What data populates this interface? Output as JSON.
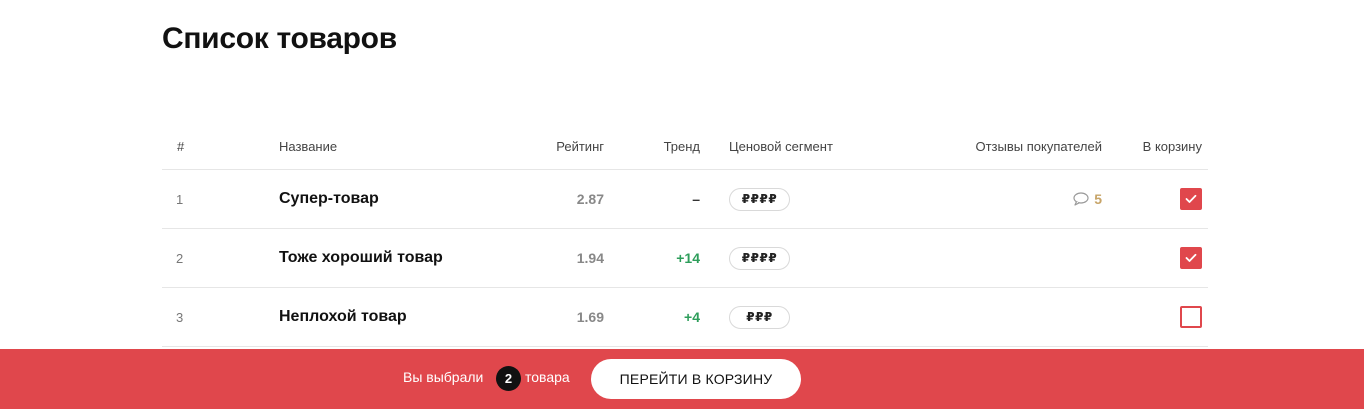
{
  "page": {
    "title": "Список товаров"
  },
  "table": {
    "headers": {
      "num": "#",
      "name": "Название",
      "rating": "Рейтинг",
      "trend": "Тренд",
      "segment": "Ценовой сегмент",
      "reviews": "Отзывы покупателей",
      "cart": "В корзину"
    },
    "rows": [
      {
        "num": "1",
        "name": "Супер-товар",
        "rating": "2.87",
        "trend": "–",
        "segment": "₽₽₽₽",
        "reviews": "5",
        "in_cart": true
      },
      {
        "num": "2",
        "name": "Тоже хороший товар",
        "rating": "1.94",
        "trend": "+14",
        "segment": "₽₽₽₽",
        "reviews": "",
        "in_cart": true
      },
      {
        "num": "3",
        "name": "Неплохой товар",
        "rating": "1.69",
        "trend": "+4",
        "segment": "₽₽₽",
        "reviews": "",
        "in_cart": false
      }
    ]
  },
  "selection_bar": {
    "prefix": "Вы выбрали",
    "count": "2",
    "suffix": "товара",
    "button_label": "ПЕРЕЙТИ В КОРЗИНУ"
  },
  "icons": {
    "reviews": "comment-icon",
    "checkmark": "checkmark-icon"
  },
  "colors": {
    "accent": "#e0474c",
    "trend_positive": "#2e9e5b",
    "reviews": "#c7a468",
    "badge": "#111111"
  }
}
